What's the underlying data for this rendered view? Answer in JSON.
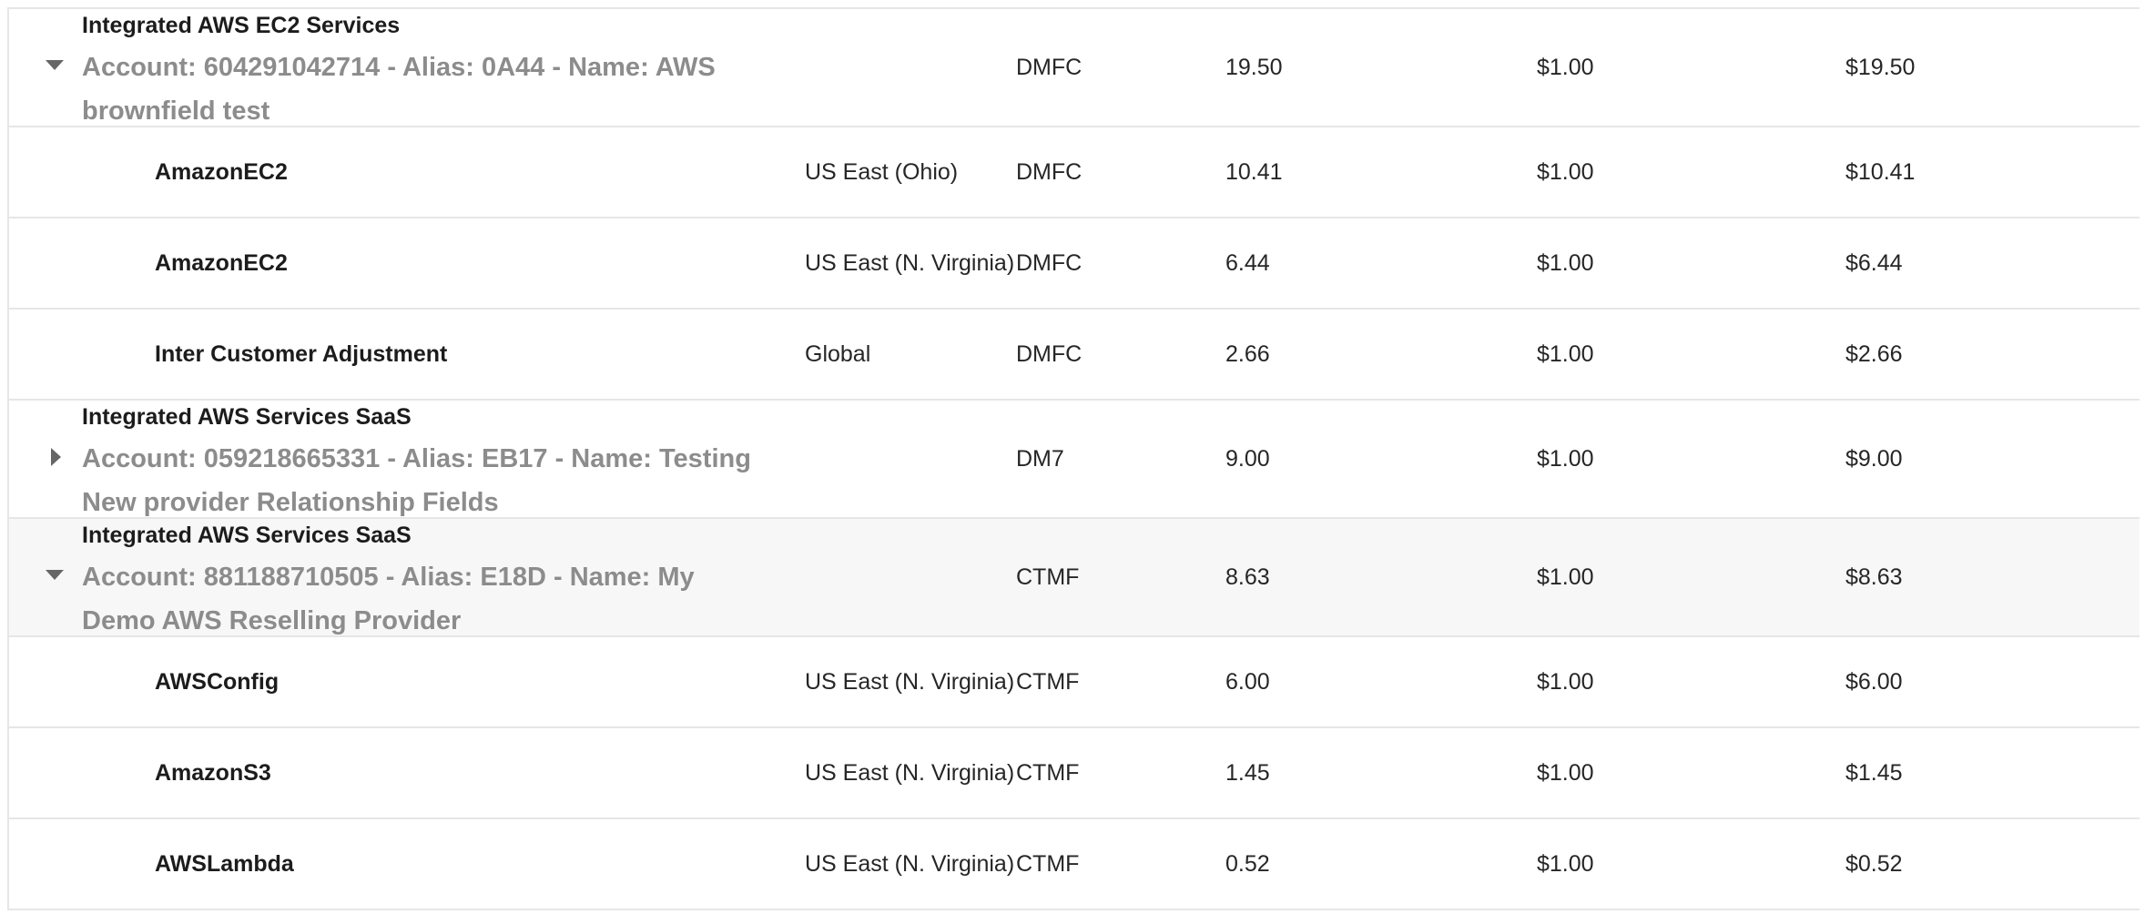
{
  "rows": [
    {
      "kind": "group",
      "expanded": true,
      "title": "Integrated AWS EC2 Services",
      "account": "Account: 604291042714 - Alias: 0A44 - Name: AWS brownfield test",
      "plan": "DMFC",
      "qty": "19.50",
      "rate": "$1.00",
      "total": "$19.50"
    },
    {
      "kind": "child",
      "name": "AmazonEC2",
      "region": "US East (Ohio)",
      "plan": "DMFC",
      "qty": "10.41",
      "rate": "$1.00",
      "total": "$10.41"
    },
    {
      "kind": "child",
      "name": "AmazonEC2",
      "region": "US East (N. Virginia)",
      "plan": "DMFC",
      "qty": "6.44",
      "rate": "$1.00",
      "total": "$6.44"
    },
    {
      "kind": "child",
      "name": "Inter Customer Adjustment",
      "region": "Global",
      "plan": "DMFC",
      "qty": "2.66",
      "rate": "$1.00",
      "total": "$2.66"
    },
    {
      "kind": "group",
      "expanded": false,
      "title": "Integrated AWS Services SaaS",
      "account": "Account: 059218665331 - Alias: EB17 - Name: Testing New provider Relationship Fields",
      "plan": "DM7",
      "qty": "9.00",
      "rate": "$1.00",
      "total": "$9.00"
    },
    {
      "kind": "group",
      "expanded": true,
      "highlight": true,
      "title": "Integrated AWS Services SaaS",
      "account": "Account: 881188710505 - Alias: E18D - Name: My Demo AWS Reselling Provider",
      "plan": "CTMF",
      "qty": "8.63",
      "rate": "$1.00",
      "total": "$8.63"
    },
    {
      "kind": "child",
      "name": "AWSConfig",
      "region": "US East (N. Virginia)",
      "plan": "CTMF",
      "qty": "6.00",
      "rate": "$1.00",
      "total": "$6.00"
    },
    {
      "kind": "child",
      "name": "AmazonS3",
      "region": "US East (N. Virginia)",
      "plan": "CTMF",
      "qty": "1.45",
      "rate": "$1.00",
      "total": "$1.45"
    },
    {
      "kind": "child",
      "name": "AWSLambda",
      "region": "US East (N. Virginia)",
      "plan": "CTMF",
      "qty": "0.52",
      "rate": "$1.00",
      "total": "$0.52"
    }
  ]
}
